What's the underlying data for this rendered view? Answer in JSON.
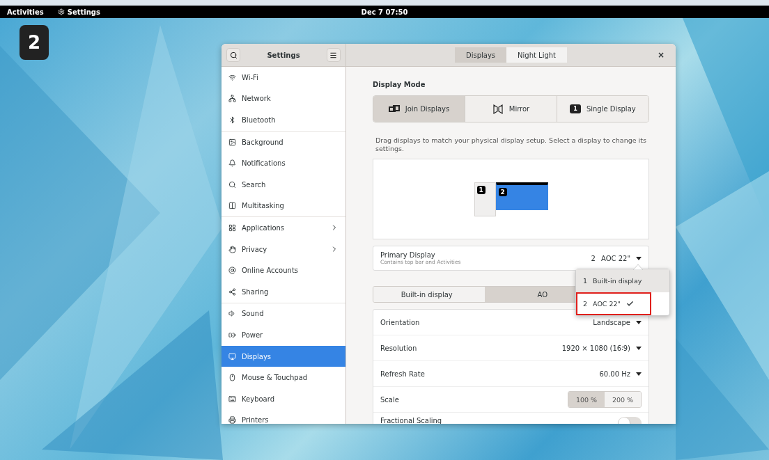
{
  "top_bar": {
    "activities": "Activities",
    "app_name": "Settings",
    "clock": "Dec 7 07:50"
  },
  "workspace_badge": "2",
  "window": {
    "title": "Settings",
    "sidebar": {
      "sections": [
        {
          "items": [
            {
              "label": "Wi-Fi",
              "selected": false,
              "submenu": false
            },
            {
              "label": "Network",
              "selected": false,
              "submenu": false
            },
            {
              "label": "Bluetooth",
              "selected": false,
              "submenu": false
            }
          ]
        },
        {
          "items": [
            {
              "label": "Background",
              "selected": false,
              "submenu": false
            },
            {
              "label": "Notifications",
              "selected": false,
              "submenu": false
            },
            {
              "label": "Search",
              "selected": false,
              "submenu": false
            },
            {
              "label": "Multitasking",
              "selected": false,
              "submenu": false
            }
          ]
        },
        {
          "items": [
            {
              "label": "Applications",
              "selected": false,
              "submenu": true
            },
            {
              "label": "Privacy",
              "selected": false,
              "submenu": true
            },
            {
              "label": "Online Accounts",
              "selected": false,
              "submenu": false
            },
            {
              "label": "Sharing",
              "selected": false,
              "submenu": false
            }
          ]
        },
        {
          "items": [
            {
              "label": "Sound",
              "selected": false,
              "submenu": false
            },
            {
              "label": "Power",
              "selected": false,
              "submenu": false
            },
            {
              "label": "Displays",
              "selected": true,
              "submenu": false
            },
            {
              "label": "Mouse & Touchpad",
              "selected": false,
              "submenu": false
            },
            {
              "label": "Keyboard",
              "selected": false,
              "submenu": false
            },
            {
              "label": "Printers",
              "selected": false,
              "submenu": false
            }
          ]
        }
      ]
    },
    "header_tabs": [
      {
        "label": "Displays",
        "selected": true
      },
      {
        "label": "Night Light",
        "selected": false
      }
    ],
    "close": "×",
    "display_mode": {
      "heading": "Display Mode",
      "modes": [
        {
          "kind": "join",
          "label": "Join Displays",
          "selected": true
        },
        {
          "kind": "mirror",
          "label": "Mirror",
          "selected": false
        },
        {
          "kind": "single",
          "label": "Single Display",
          "selected": false,
          "icon_text": "1"
        }
      ]
    },
    "description": "Drag displays to match your physical display setup. Select a display to change its settings.",
    "arrangement": {
      "monitors": [
        {
          "number": "1",
          "selected": false,
          "primary": false
        },
        {
          "number": "2",
          "selected": true,
          "primary": true
        }
      ]
    },
    "primary_display": {
      "title": "Primary Display",
      "subtitle": "Contains top bar and Activities",
      "number": "2",
      "value": "AOC 22\""
    },
    "display_tabs": [
      {
        "label": "Built-in display",
        "selected": false
      },
      {
        "label": "AO",
        "selected": true
      }
    ],
    "settings": [
      {
        "kind": "dropdown",
        "label": "Orientation",
        "value": "Landscape"
      },
      {
        "kind": "dropdown",
        "label": "Resolution",
        "value": "1920 × 1080 (16∶9)"
      },
      {
        "kind": "dropdown",
        "label": "Refresh Rate",
        "value": "60.00 Hz"
      },
      {
        "kind": "segmented",
        "label": "Scale",
        "options": [
          {
            "label": "100 %",
            "selected": true
          },
          {
            "label": "200 %",
            "selected": false
          }
        ]
      },
      {
        "kind": "switch",
        "label": "Fractional Scaling",
        "on": false
      }
    ],
    "popover": {
      "items": [
        {
          "number": "1",
          "label": "Built-in display",
          "selected": false,
          "hovered": true,
          "annotated": false
        },
        {
          "number": "2",
          "label": "AOC 22\"",
          "selected": true,
          "hovered": false,
          "annotated": true
        }
      ]
    }
  }
}
